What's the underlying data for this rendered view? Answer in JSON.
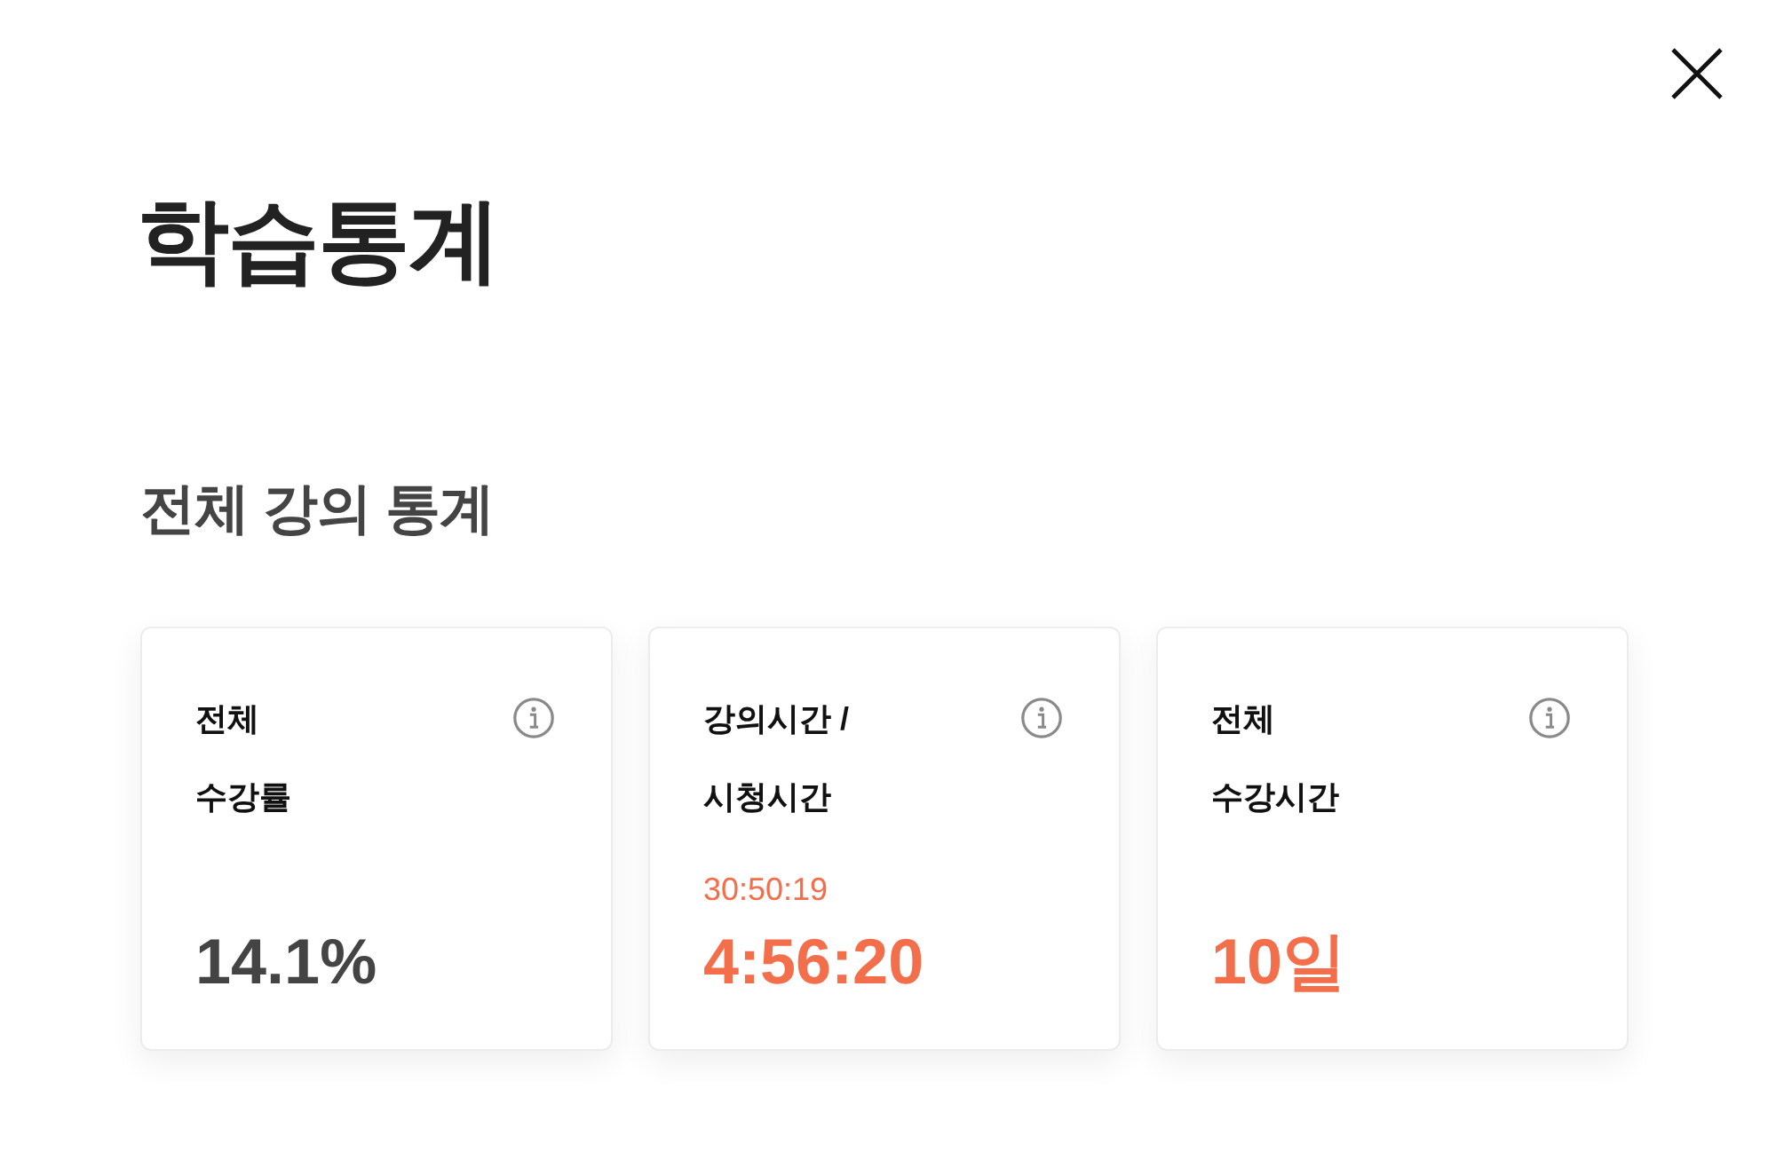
{
  "title": "학습통계",
  "section": {
    "title": "전체 강의 통계"
  },
  "cards": [
    {
      "label": "전체\n수강률",
      "value": "14.1%",
      "highlighted": false
    },
    {
      "label": "강의시간 /\n시청시간",
      "sub_value": "30:50:19",
      "value": "4:56:20",
      "highlighted": true
    },
    {
      "label": "전체\n수강시간",
      "value": "10일",
      "highlighted": true
    }
  ]
}
